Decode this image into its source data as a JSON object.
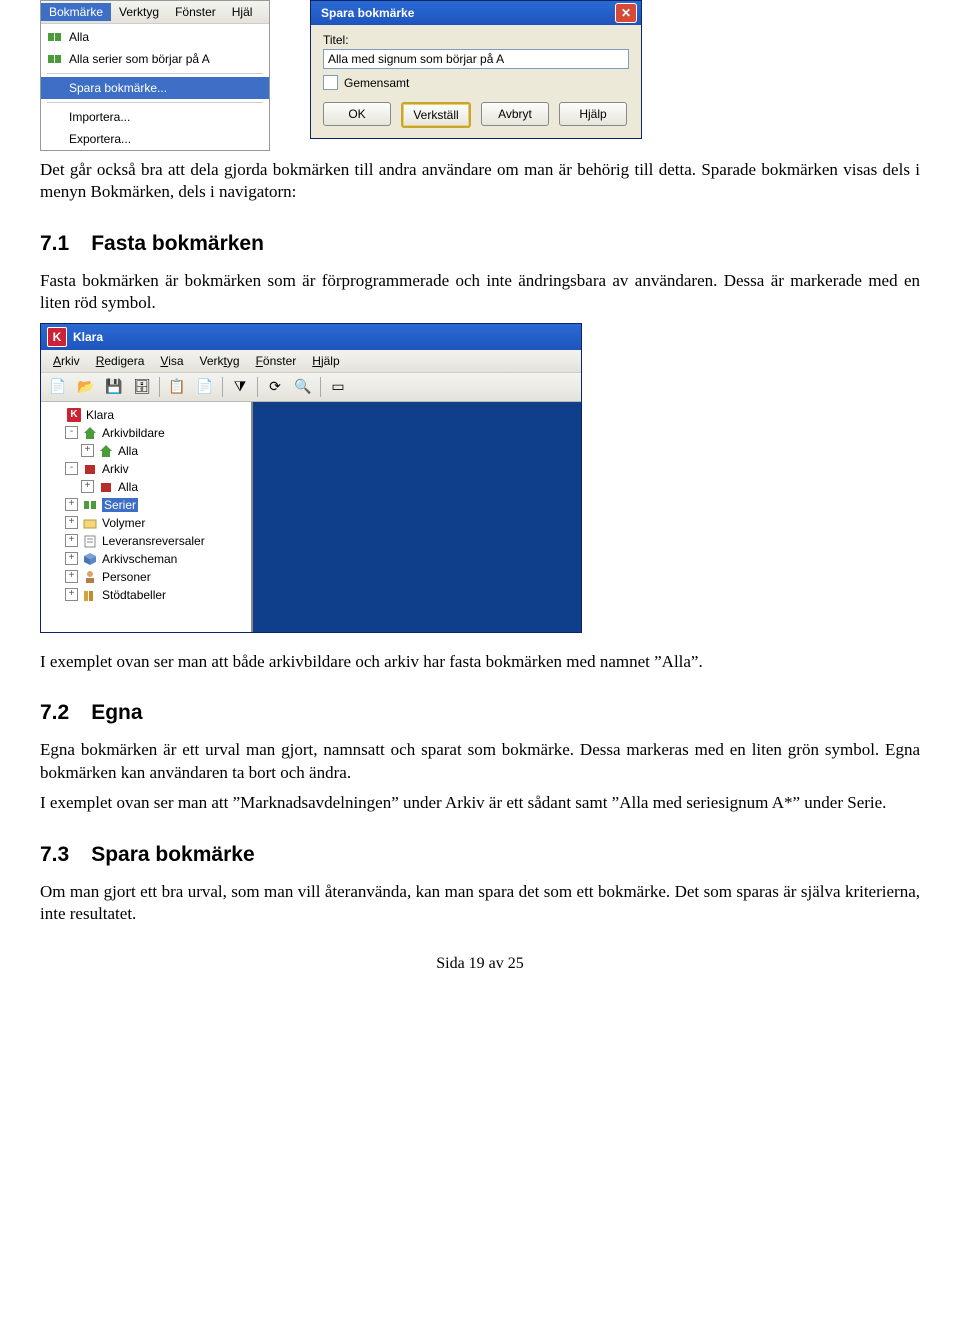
{
  "menu_shot": {
    "menubar": [
      "Bokmärke",
      "Verktyg",
      "Fönster",
      "Hjäl"
    ],
    "items": [
      {
        "label": "Alla",
        "icon": "green"
      },
      {
        "label": "Alla serier som börjar på A",
        "icon": "green"
      },
      {
        "label": "Spara bokmärke...",
        "selected": true
      },
      {
        "label": "Importera..."
      },
      {
        "label": "Exportera..."
      }
    ]
  },
  "dialog": {
    "title": "Spara bokmärke",
    "field_label": "Titel:",
    "field_value": "Alla med signum som börjar på A",
    "checkbox_label": "Gemensamt",
    "buttons": [
      "OK",
      "Verkställ",
      "Avbryt",
      "Hjälp"
    ]
  },
  "para1": "Det går också bra att dela gjorda bokmärken till andra användare om man är behörig till detta. Sparade bokmärken visas dels i menyn Bokmärken, dels i navigatorn:",
  "sec71_num": "7.1",
  "sec71_title": "Fasta bokmärken",
  "para2": "Fasta bokmärken är bokmärken som är förprogrammerade och inte ändringsbara av användaren. Dessa är markerade med en liten röd symbol.",
  "klara": {
    "title": "Klara",
    "menubar": [
      "Arkiv",
      "Redigera",
      "Visa",
      "Verktyg",
      "Fönster",
      "Hjälp"
    ],
    "tree": [
      {
        "indent": 0,
        "exp": "",
        "icon": "K",
        "label": "Klara"
      },
      {
        "indent": 1,
        "exp": "-",
        "icon": "home-green",
        "label": "Arkivbildare"
      },
      {
        "indent": 2,
        "exp": "+",
        "icon": "home-green",
        "label": "Alla"
      },
      {
        "indent": 1,
        "exp": "-",
        "icon": "red-box",
        "label": "Arkiv"
      },
      {
        "indent": 2,
        "exp": "+",
        "icon": "red-box",
        "label": "Alla"
      },
      {
        "indent": 1,
        "exp": "+",
        "icon": "bm-green",
        "label": "Serier",
        "selected": true
      },
      {
        "indent": 1,
        "exp": "+",
        "icon": "folder",
        "label": "Volymer"
      },
      {
        "indent": 1,
        "exp": "+",
        "icon": "doc",
        "label": "Leveransreversaler"
      },
      {
        "indent": 1,
        "exp": "+",
        "icon": "cube-blue",
        "label": "Arkivscheman"
      },
      {
        "indent": 1,
        "exp": "+",
        "icon": "person",
        "label": "Personer"
      },
      {
        "indent": 1,
        "exp": "+",
        "icon": "books",
        "label": "Stödtabeller"
      }
    ]
  },
  "para3": "I exemplet ovan ser man att både arkivbildare och arkiv har fasta bokmärken med namnet ”Alla”.",
  "sec72_num": "7.2",
  "sec72_title": "Egna",
  "para4": "Egna bokmärken är ett urval man gjort, namnsatt och sparat som bokmärke. Dessa markeras med en liten grön symbol. Egna bokmärken kan användaren ta bort och ändra.",
  "para5": "I exemplet ovan ser man att ”Marknadsavdelningen” under Arkiv är ett sådant samt ”Alla med seriesignum A*” under Serie.",
  "sec73_num": "7.3",
  "sec73_title": "Spara bokmärke",
  "para6": "Om man gjort ett bra urval, som man vill återanvända, kan man spara det som ett bokmärke. Det som sparas är själva kriterierna, inte resultatet.",
  "footer": "Sida 19 av 25"
}
